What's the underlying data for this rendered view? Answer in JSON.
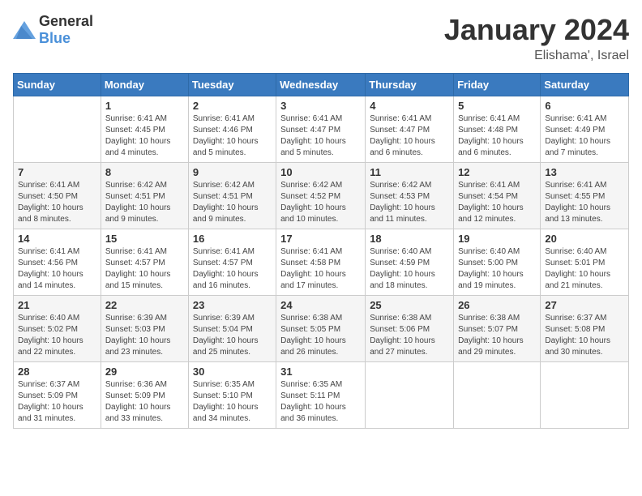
{
  "header": {
    "logo_general": "General",
    "logo_blue": "Blue",
    "title": "January 2024",
    "location": "Elishama', Israel"
  },
  "weekdays": [
    "Sunday",
    "Monday",
    "Tuesday",
    "Wednesday",
    "Thursday",
    "Friday",
    "Saturday"
  ],
  "weeks": [
    [
      {
        "day": "",
        "info": ""
      },
      {
        "day": "1",
        "info": "Sunrise: 6:41 AM\nSunset: 4:45 PM\nDaylight: 10 hours\nand 4 minutes."
      },
      {
        "day": "2",
        "info": "Sunrise: 6:41 AM\nSunset: 4:46 PM\nDaylight: 10 hours\nand 5 minutes."
      },
      {
        "day": "3",
        "info": "Sunrise: 6:41 AM\nSunset: 4:47 PM\nDaylight: 10 hours\nand 5 minutes."
      },
      {
        "day": "4",
        "info": "Sunrise: 6:41 AM\nSunset: 4:47 PM\nDaylight: 10 hours\nand 6 minutes."
      },
      {
        "day": "5",
        "info": "Sunrise: 6:41 AM\nSunset: 4:48 PM\nDaylight: 10 hours\nand 6 minutes."
      },
      {
        "day": "6",
        "info": "Sunrise: 6:41 AM\nSunset: 4:49 PM\nDaylight: 10 hours\nand 7 minutes."
      }
    ],
    [
      {
        "day": "7",
        "info": "Sunrise: 6:41 AM\nSunset: 4:50 PM\nDaylight: 10 hours\nand 8 minutes."
      },
      {
        "day": "8",
        "info": "Sunrise: 6:42 AM\nSunset: 4:51 PM\nDaylight: 10 hours\nand 9 minutes."
      },
      {
        "day": "9",
        "info": "Sunrise: 6:42 AM\nSunset: 4:51 PM\nDaylight: 10 hours\nand 9 minutes."
      },
      {
        "day": "10",
        "info": "Sunrise: 6:42 AM\nSunset: 4:52 PM\nDaylight: 10 hours\nand 10 minutes."
      },
      {
        "day": "11",
        "info": "Sunrise: 6:42 AM\nSunset: 4:53 PM\nDaylight: 10 hours\nand 11 minutes."
      },
      {
        "day": "12",
        "info": "Sunrise: 6:41 AM\nSunset: 4:54 PM\nDaylight: 10 hours\nand 12 minutes."
      },
      {
        "day": "13",
        "info": "Sunrise: 6:41 AM\nSunset: 4:55 PM\nDaylight: 10 hours\nand 13 minutes."
      }
    ],
    [
      {
        "day": "14",
        "info": "Sunrise: 6:41 AM\nSunset: 4:56 PM\nDaylight: 10 hours\nand 14 minutes."
      },
      {
        "day": "15",
        "info": "Sunrise: 6:41 AM\nSunset: 4:57 PM\nDaylight: 10 hours\nand 15 minutes."
      },
      {
        "day": "16",
        "info": "Sunrise: 6:41 AM\nSunset: 4:57 PM\nDaylight: 10 hours\nand 16 minutes."
      },
      {
        "day": "17",
        "info": "Sunrise: 6:41 AM\nSunset: 4:58 PM\nDaylight: 10 hours\nand 17 minutes."
      },
      {
        "day": "18",
        "info": "Sunrise: 6:40 AM\nSunset: 4:59 PM\nDaylight: 10 hours\nand 18 minutes."
      },
      {
        "day": "19",
        "info": "Sunrise: 6:40 AM\nSunset: 5:00 PM\nDaylight: 10 hours\nand 19 minutes."
      },
      {
        "day": "20",
        "info": "Sunrise: 6:40 AM\nSunset: 5:01 PM\nDaylight: 10 hours\nand 21 minutes."
      }
    ],
    [
      {
        "day": "21",
        "info": "Sunrise: 6:40 AM\nSunset: 5:02 PM\nDaylight: 10 hours\nand 22 minutes."
      },
      {
        "day": "22",
        "info": "Sunrise: 6:39 AM\nSunset: 5:03 PM\nDaylight: 10 hours\nand 23 minutes."
      },
      {
        "day": "23",
        "info": "Sunrise: 6:39 AM\nSunset: 5:04 PM\nDaylight: 10 hours\nand 25 minutes."
      },
      {
        "day": "24",
        "info": "Sunrise: 6:38 AM\nSunset: 5:05 PM\nDaylight: 10 hours\nand 26 minutes."
      },
      {
        "day": "25",
        "info": "Sunrise: 6:38 AM\nSunset: 5:06 PM\nDaylight: 10 hours\nand 27 minutes."
      },
      {
        "day": "26",
        "info": "Sunrise: 6:38 AM\nSunset: 5:07 PM\nDaylight: 10 hours\nand 29 minutes."
      },
      {
        "day": "27",
        "info": "Sunrise: 6:37 AM\nSunset: 5:08 PM\nDaylight: 10 hours\nand 30 minutes."
      }
    ],
    [
      {
        "day": "28",
        "info": "Sunrise: 6:37 AM\nSunset: 5:09 PM\nDaylight: 10 hours\nand 31 minutes."
      },
      {
        "day": "29",
        "info": "Sunrise: 6:36 AM\nSunset: 5:09 PM\nDaylight: 10 hours\nand 33 minutes."
      },
      {
        "day": "30",
        "info": "Sunrise: 6:35 AM\nSunset: 5:10 PM\nDaylight: 10 hours\nand 34 minutes."
      },
      {
        "day": "31",
        "info": "Sunrise: 6:35 AM\nSunset: 5:11 PM\nDaylight: 10 hours\nand 36 minutes."
      },
      {
        "day": "",
        "info": ""
      },
      {
        "day": "",
        "info": ""
      },
      {
        "day": "",
        "info": ""
      }
    ]
  ]
}
